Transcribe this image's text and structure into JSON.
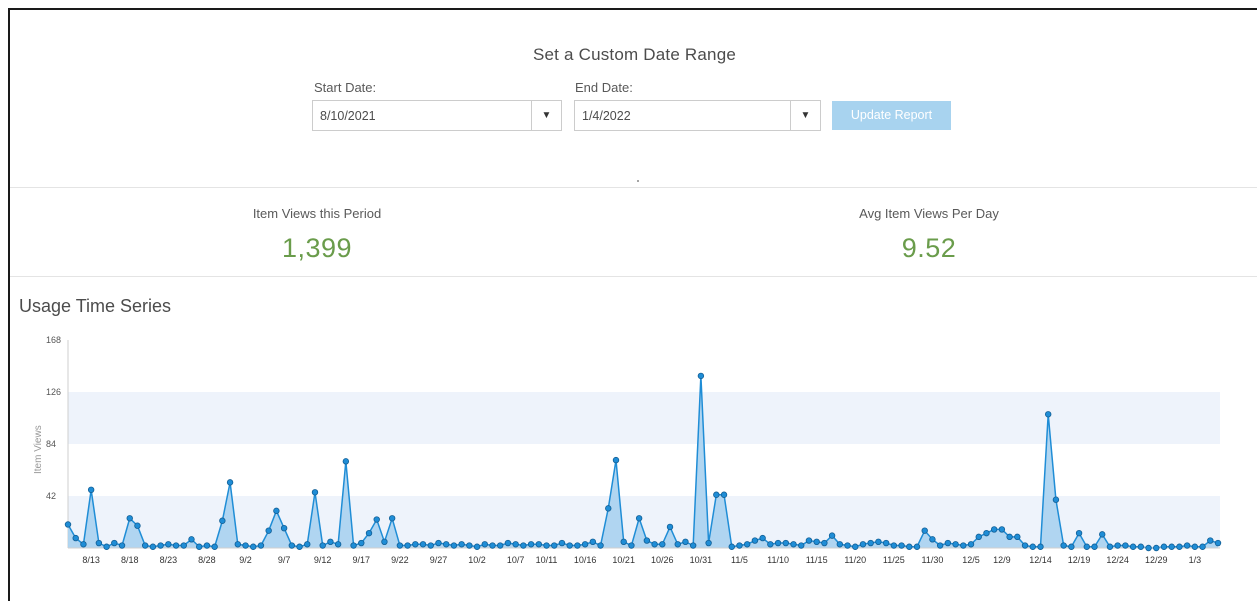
{
  "date_range": {
    "title": "Set a Custom Date Range",
    "start_label": "Start Date:",
    "start_value": "8/10/2021",
    "end_label": "End Date:",
    "end_value": "1/4/2022",
    "update_button": "Update Report",
    "dropdown_icon": "triangle-down-icon"
  },
  "stats": {
    "views_label": "Item Views this Period",
    "views_value": "1,399",
    "avg_label": "Avg Item Views Per Day",
    "avg_value": "9.52"
  },
  "section_title": "Usage Time Series",
  "colors": {
    "stat_value": "#6a9c4b",
    "series_line": "#1f8dd6",
    "series_fill": "#a9d2ef",
    "band_fill": "#eef3fb",
    "button_disabled": "#a8d3ef"
  },
  "chart_data": {
    "type": "area",
    "title": "",
    "xlabel": "",
    "ylabel": "Item Views",
    "ylim": [
      0,
      168
    ],
    "yticks": [
      42,
      84,
      126,
      168
    ],
    "grid": "alternating horizontal bands",
    "x_tick_labels": [
      "8/13",
      "8/18",
      "8/23",
      "8/28",
      "9/2",
      "9/7",
      "9/12",
      "9/17",
      "9/22",
      "9/27",
      "10/2",
      "10/7",
      "10/11",
      "10/16",
      "10/21",
      "10/26",
      "10/31",
      "11/5",
      "11/10",
      "11/15",
      "11/20",
      "11/25",
      "11/30",
      "12/5",
      "12/9",
      "12/14",
      "12/19",
      "12/24",
      "12/29",
      "1/3"
    ],
    "series": [
      {
        "values": [
          19,
          8,
          3,
          47,
          4,
          1,
          4,
          2,
          24,
          18,
          2,
          1,
          2,
          3,
          2,
          2,
          7,
          1,
          2,
          1,
          22,
          53,
          3,
          2,
          1,
          2,
          14,
          30,
          16,
          2,
          1,
          3,
          45,
          2,
          5,
          3,
          70,
          2,
          4,
          12,
          23,
          5,
          24,
          2,
          2,
          3,
          3,
          2,
          4,
          3,
          2,
          3,
          2,
          1,
          3,
          2,
          2,
          4,
          3,
          2,
          3,
          3,
          2,
          2,
          4,
          2,
          2,
          3,
          5,
          2,
          32,
          71,
          5,
          2,
          24,
          6,
          3,
          3,
          17,
          3,
          5,
          2,
          139,
          4,
          43,
          43,
          1,
          2,
          3,
          6,
          8,
          3,
          4,
          4,
          3,
          2,
          6,
          5,
          4,
          10,
          3,
          2,
          1,
          3,
          4,
          5,
          4,
          2,
          2,
          1,
          1,
          14,
          7,
          2,
          4,
          3,
          2,
          3,
          9,
          12,
          15,
          15,
          9,
          9,
          2,
          1,
          1,
          108,
          39,
          2,
          1,
          12,
          1,
          1,
          11,
          1,
          2,
          2,
          1,
          1,
          0,
          0,
          1,
          1,
          1,
          2,
          1,
          1,
          6,
          4
        ]
      }
    ]
  }
}
